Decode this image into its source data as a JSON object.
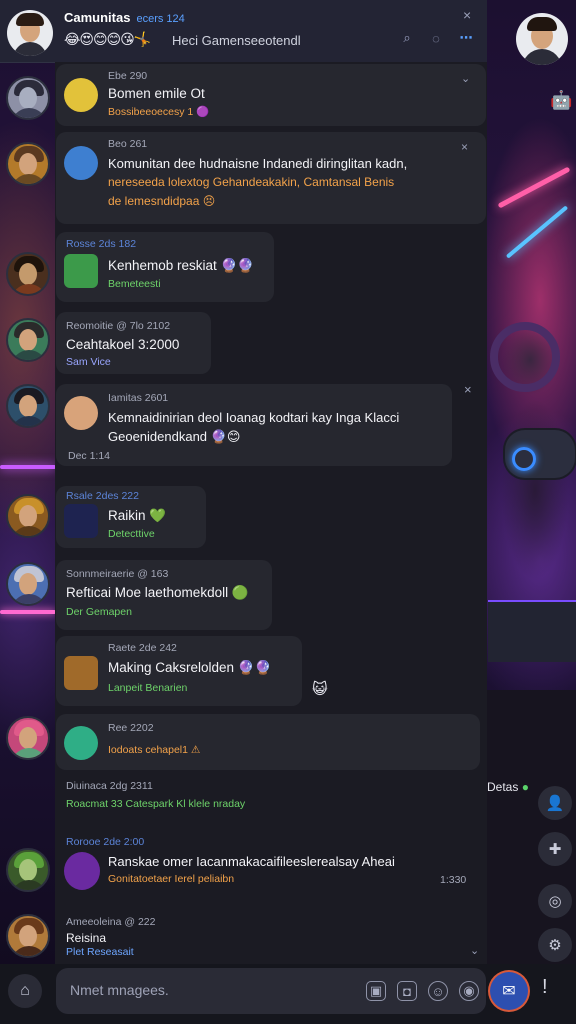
{
  "header": {
    "title": "Camunitas",
    "subtitle": "ecers 124",
    "reactions": "😂😍😊😊😘🤸",
    "text": "Heci Gamenseeotendl",
    "search_icon": "search-icon",
    "chat_icon": "chat-icon",
    "more_icon": "more-icon",
    "close_icon": "×"
  },
  "messages": [
    {
      "meta": "Ebe 290",
      "body": "Bomen emile Ot",
      "sub": "Bossibeeoecesy 1",
      "emoji": "🟣"
    },
    {
      "meta": "Beo 261",
      "line1": "Komunitan dee hudnaisne Indanedi diringlitan kadn,",
      "line2": "nereseeda lolextog Gehandeakakin, Camtansal Benis",
      "line3": "de lemesndidpaa",
      "emoji": "😣"
    },
    {
      "meta": "Rosse 2ds 182",
      "body": "Kenhemob reskiat",
      "sub": "Bemeteesti",
      "emoji": "🔮🔮"
    },
    {
      "meta": "Reomoitie @ 7lo 2102",
      "body": "Ceahtakoel 3:2000",
      "sub": "Sam Vice"
    },
    {
      "meta": "Iamitas 2601",
      "line1": "Kemnaidinirian deol Ioanag kodtari kay Inga Klacci",
      "line2": "Geoenidendkand",
      "sub": "Dec 1:14",
      "emoji": "🔮😊"
    },
    {
      "meta": "Rsale 2des 222",
      "body": "Raikin",
      "sub": "Detecttive",
      "emoji": "💚"
    },
    {
      "meta": "Sonnmeiraerie @ 163",
      "body": "Refticai Moe laethomekdoll",
      "sub": "Der Gemapen",
      "emoji": "🟢"
    },
    {
      "meta": "Raete 2de 242",
      "body": "Making Caksrelolden",
      "sub": "Lanpeit Benarien",
      "emoji": "🔮🔮"
    },
    {
      "meta": "Ree 2202",
      "body": "Iodoats cehapel1",
      "emoji": "⚠"
    },
    {
      "meta": "Diuinaca 2dg 2311",
      "body": "Roacmat 33  Catespark Kl klele nraday"
    },
    {
      "meta": "Rorooe 2de 2:00",
      "line1": "Ranskae omer Iacanmakacaifileeslerealsay Aheai",
      "line2": "Gonitatoetaer Ierel peliaibn",
      "time": "1:330"
    },
    {
      "meta": "Ameeoleina @ 222",
      "body": "Reisina",
      "sub": "Plet Reseasait"
    }
  ],
  "online": "Detas",
  "input": {
    "placeholder": "Nmet mnagees.",
    "send_icon": "send-icon",
    "mic_icon": "mic-icon"
  }
}
